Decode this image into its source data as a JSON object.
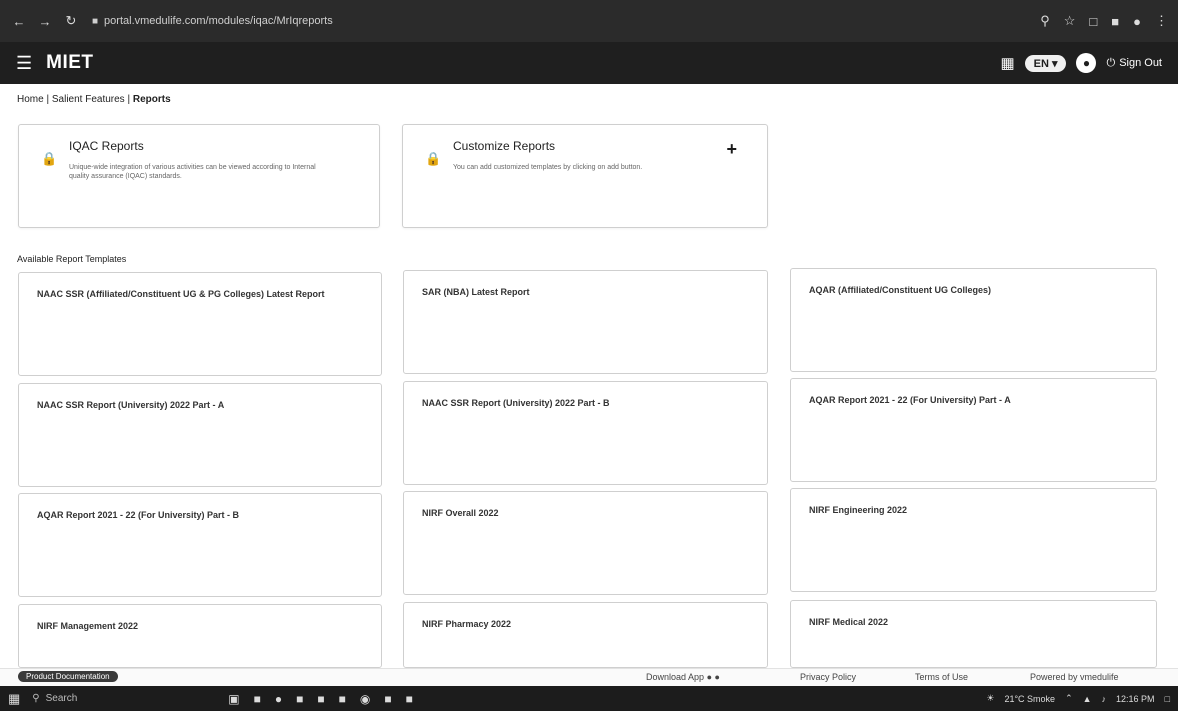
{
  "browser": {
    "url": "portal.vmedulife.com/modules/iqac/MrIqreports",
    "back": "←",
    "forward": "→",
    "reload": "↻"
  },
  "header": {
    "brand": "MIET",
    "language": "EN ▾",
    "sign_out": "Sign Out"
  },
  "breadcrumb": {
    "home": "Home",
    "salient": "Salient Features",
    "current": "Reports",
    "sep": "|"
  },
  "top_cards": [
    {
      "title": "IQAC Reports",
      "description": "Unique-wide integration of various activities can be viewed according to Internal quality assurance (IQAC) standards."
    },
    {
      "title": "Customize Reports",
      "description": "You can add customized templates by clicking on add button."
    }
  ],
  "section_label": "Available Report Templates",
  "templates": [
    "NAAC SSR (Affiliated/Constituent UG & PG Colleges) Latest Report",
    "SAR (NBA) Latest Report",
    "AQAR (Affiliated/Constituent UG Colleges)",
    "NAAC SSR Report (University) 2022 Part - A",
    "NAAC SSR Report (University) 2022 Part - B",
    "AQAR Report 2021 - 22 (For University) Part - A",
    "AQAR Report 2021 - 22 (For University) Part - B",
    "NIRF Overall 2022",
    "NIRF Engineering 2022",
    "NIRF Management 2022",
    "NIRF Pharmacy 2022",
    "NIRF Medical 2022"
  ],
  "footer": {
    "product_chip": "Product Documentation",
    "download_app": "Download App",
    "privacy": "Privacy Policy",
    "terms": "Terms of Use",
    "powered": "Powered by vmedulife"
  },
  "taskbar": {
    "search": "Search",
    "weather": "21°C Smoke",
    "time": "12:16 PM"
  }
}
